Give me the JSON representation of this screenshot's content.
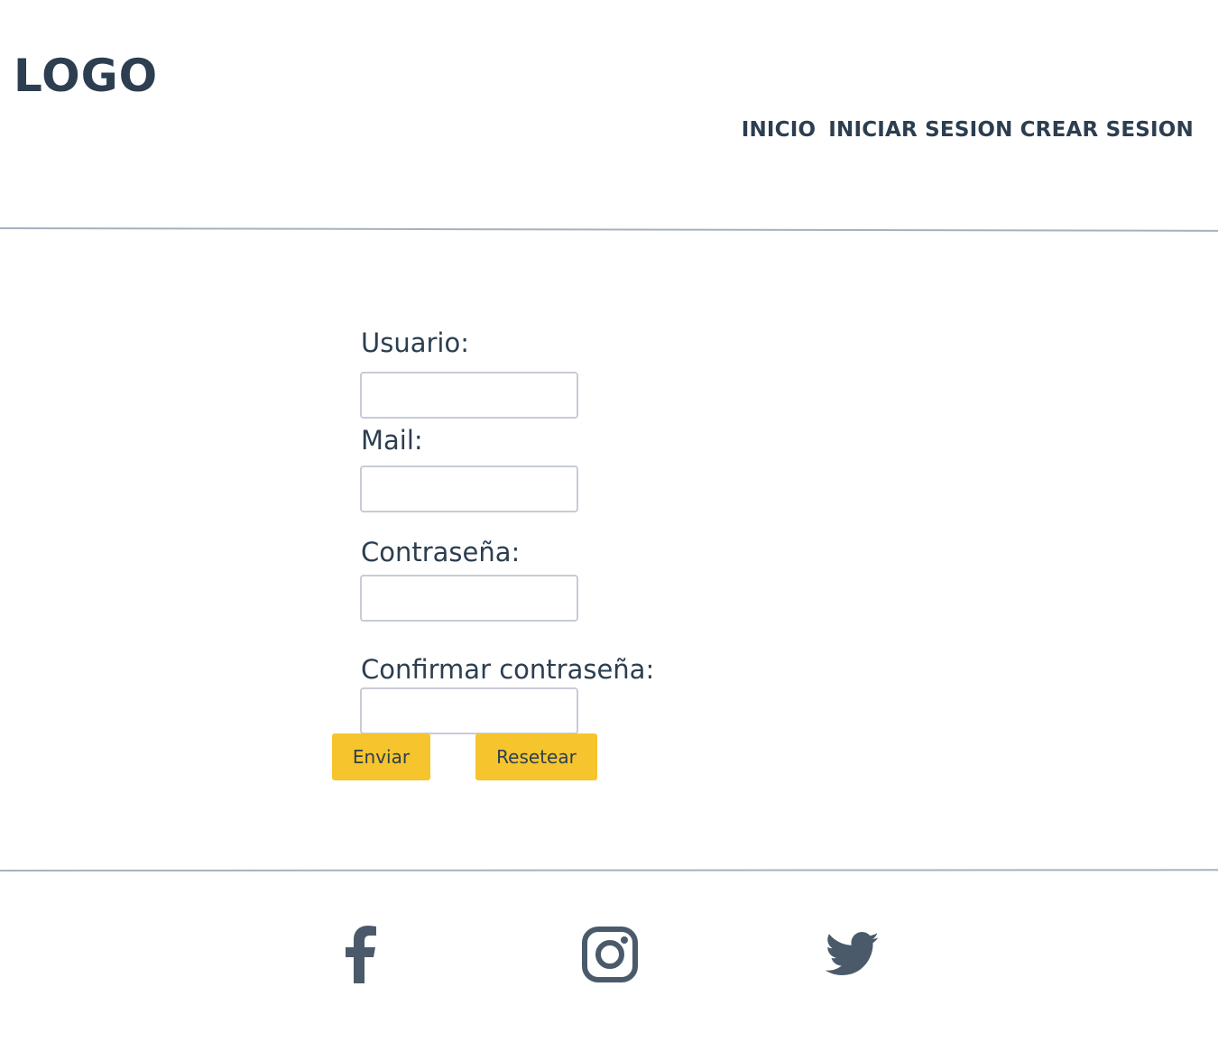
{
  "header": {
    "logo": "LOGO",
    "nav": [
      {
        "label": "INICIO"
      },
      {
        "label": "INICIAR SESION"
      },
      {
        "label": "CREAR SESION"
      }
    ]
  },
  "form": {
    "usuario_label": "Usuario:",
    "mail_label": "Mail:",
    "password_label": "Contraseña:",
    "confirm_label": "Confirmar contraseña:",
    "usuario_value": "",
    "mail_value": "",
    "password_value": "",
    "confirm_value": "",
    "submit_label": "Enviar",
    "reset_label": "Resetear"
  },
  "footer": {
    "social_icons": [
      "facebook-icon",
      "instagram-icon",
      "twitter-icon"
    ]
  },
  "colors": {
    "text": "#2c3e50",
    "button": "#f6c42c",
    "divider": "#a6b1bd",
    "input_border": "#c7ccd6",
    "icon": "#4a5a6a"
  }
}
